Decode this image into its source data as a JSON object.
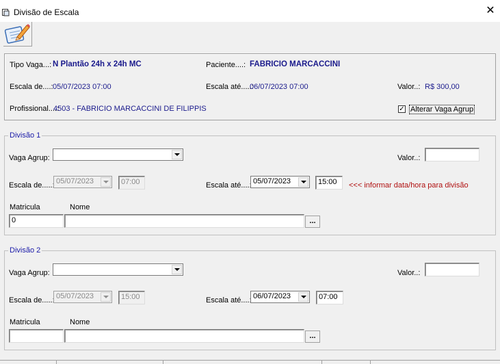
{
  "window": {
    "title": "Divisão de Escala",
    "close_icon": "close-icon"
  },
  "toolbar": {
    "icon": "notepad-pencil-icon"
  },
  "info": {
    "tipo_vaga_label": "Tipo Vaga...:",
    "tipo_vaga_value": "N Plantão 24h x 24h MC",
    "paciente_label": "Paciente....:",
    "paciente_value": "FABRICIO MARCACCINI",
    "escala_de_label": "Escala de....:",
    "escala_de_value": "05/07/2023 07:00",
    "escala_ate_label": "Escala até.....:",
    "escala_ate_value": "06/07/2023 07:00",
    "valor_label": "Valor..:",
    "valor_value": "R$ 300,00",
    "profissional_label": "Profissional....:",
    "profissional_value": "4503 - FABRICIO MARCACCINI DE FILIPPIS",
    "alterar_label": "Alterar Vaga Agrup",
    "alterar_checked": "✓"
  },
  "divisao1": {
    "title": "Divisão 1",
    "vaga_agrup_label": "Vaga Agrup:",
    "vaga_agrup_value": "",
    "valor_label": "Valor..:",
    "valor_value": "",
    "escala_de_label": "Escala de.....:",
    "escala_de_date": "05/07/2023",
    "escala_de_time": "07:00",
    "escala_ate_label": "Escala até....:",
    "escala_ate_date": "05/07/2023",
    "escala_ate_time": "15:00",
    "warning": "<<< informar data/hora para divisão",
    "matricula_label": "Matricula",
    "nome_label": "Nome",
    "matricula_value": "0",
    "nome_value": "",
    "browse_label": "..."
  },
  "divisao2": {
    "title": "Divisão 2",
    "vaga_agrup_label": "Vaga Agrup:",
    "vaga_agrup_value": "",
    "valor_label": "Valor..:",
    "valor_value": "",
    "escala_de_label": "Escala de.....:",
    "escala_de_date": "05/07/2023",
    "escala_de_time": "15:00",
    "escala_ate_label": "Escala até....:",
    "escala_ate_date": "06/07/2023",
    "escala_ate_time": "07:00",
    "matricula_label": "Matricula",
    "nome_label": "Nome",
    "matricula_value": "",
    "nome_value": "",
    "browse_label": "..."
  }
}
